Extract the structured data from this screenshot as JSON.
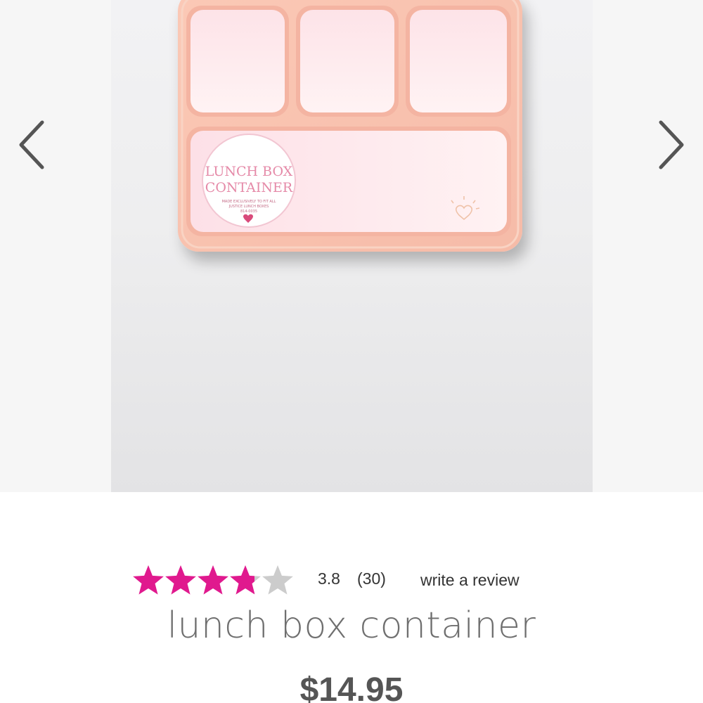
{
  "gallery": {
    "prev_icon": "chevron-left-icon",
    "next_icon": "chevron-right-icon",
    "product_image": {
      "description_icon": "lunch-box-image",
      "label_title_line1": "LUNCH BOX",
      "label_title_line2": "CONTAINER",
      "label_small_line1": "MADE EXCLUSIVELY TO FIT ALL",
      "label_small_line2": "JUSTICE LUNCH BOXES",
      "label_small_line3": "814-0035"
    }
  },
  "product": {
    "rating": {
      "stars_total": 5,
      "stars_value": 3.8,
      "value_text": "3.8",
      "count_text": "(30)",
      "write_review_label": "write a review",
      "filled_color": "#e0198e",
      "empty_color": "#cccccc"
    },
    "title": "lunch box container",
    "price": "$14.95"
  }
}
